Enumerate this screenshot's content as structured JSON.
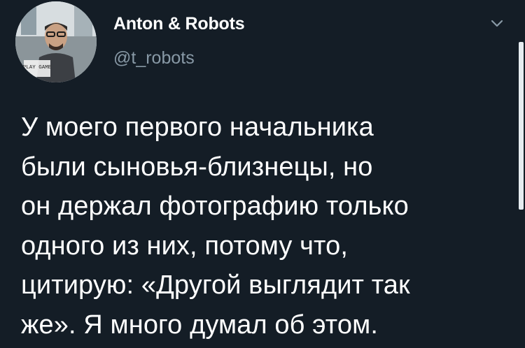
{
  "tweet": {
    "author": {
      "display_name": "Anton & Robots",
      "handle": "@t_robots",
      "avatar_text": "PLAY GAME"
    },
    "text": "У моего первого начальника\nбыли сыновья-близнецы, но\nон держал фотографию только\nодного из них, потому что,\nцитирую: «Другой выглядит так\nже». Я много думал об этом.",
    "menu_icon": "chevron-down-icon"
  },
  "colors": {
    "background": "#141d26",
    "text": "#ffffff",
    "secondary_text": "#8899a6",
    "scrollbar": "#e6ecf0"
  }
}
